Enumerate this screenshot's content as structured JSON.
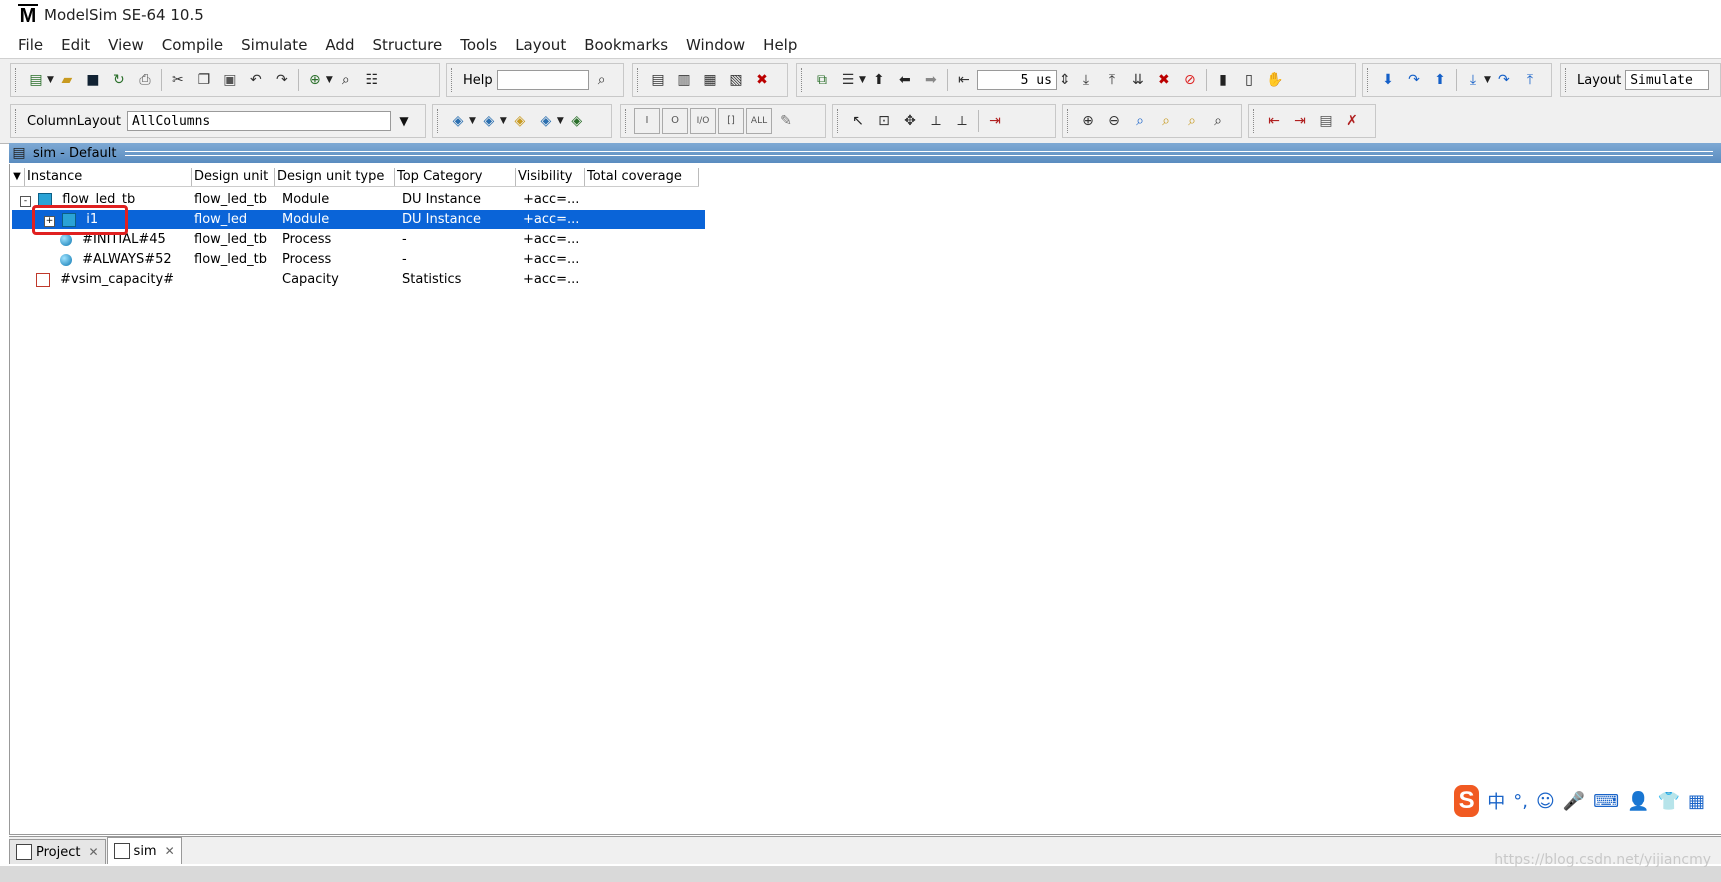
{
  "window": {
    "title": "ModelSim SE-64 10.5"
  },
  "menu": [
    "File",
    "Edit",
    "View",
    "Compile",
    "Simulate",
    "Add",
    "Structure",
    "Tools",
    "Layout",
    "Bookmarks",
    "Window",
    "Help"
  ],
  "toolbar": {
    "help_label": "Help",
    "help_value": "",
    "run_length": "5 us",
    "layout_label": "Layout",
    "layout_value": "Simulate",
    "column_layout_label": "ColumnLayout",
    "column_layout_value": "AllColumns"
  },
  "sim_window": {
    "title": "sim - Default"
  },
  "columns": [
    "Instance",
    "Design unit",
    "Design unit type",
    "Top Category",
    "Visibility",
    "Total coverage"
  ],
  "rows": [
    {
      "instance": "flow_led_tb",
      "design_unit": "flow_led_tb",
      "type": "Module",
      "category": "DU Instance",
      "visibility": "+acc=...",
      "tree": "-",
      "icon": "module-icon"
    },
    {
      "instance": "i1",
      "design_unit": "flow_led",
      "type": "Module",
      "category": "DU Instance",
      "visibility": "+acc=...",
      "tree": "+",
      "icon": "module-icon"
    },
    {
      "instance": "#INITIAL#45",
      "design_unit": "flow_led_tb",
      "type": "Process",
      "category": "-",
      "visibility": "+acc=...",
      "icon": "process-icon"
    },
    {
      "instance": "#ALWAYS#52",
      "design_unit": "flow_led_tb",
      "type": "Process",
      "category": "-",
      "visibility": "+acc=...",
      "icon": "process-icon"
    },
    {
      "instance": "#vsim_capacity#",
      "design_unit": "",
      "type": "Capacity",
      "category": "Statistics",
      "visibility": "+acc=...",
      "icon": "capacity-icon"
    }
  ],
  "selected_row": 1,
  "bottom_tabs": [
    "Project",
    "sim"
  ],
  "ime": {
    "char": "中",
    "punct": "°,"
  },
  "watermark": "https://blog.csdn.net/yijiancmy",
  "colors": {
    "selection": "#0a64d8",
    "header_blue": "#6b9bcb",
    "highlight_red": "#e02020"
  }
}
